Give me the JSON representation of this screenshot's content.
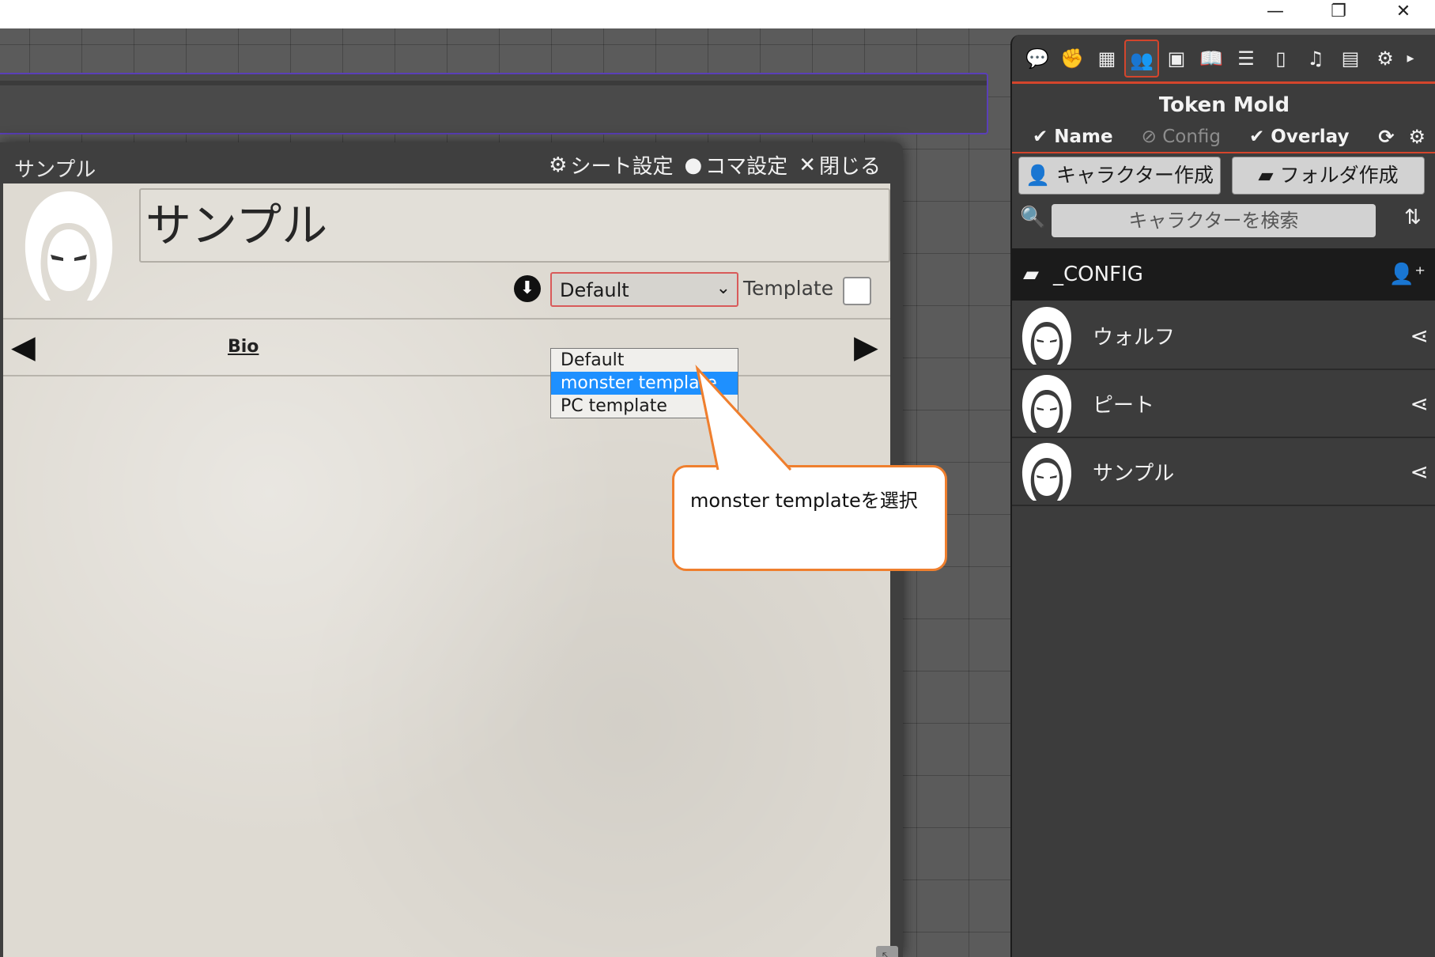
{
  "window_controls": {
    "minimize": "—",
    "restore": "❐",
    "close": "✕"
  },
  "dialog": {
    "title": "サンプル",
    "actions": {
      "sheet_settings": "シート設定",
      "token_settings": "コマ設定",
      "close": "閉じる"
    },
    "character_name": "サンプル",
    "template_select": {
      "selected": "Default",
      "options": [
        "Default",
        "monster template",
        "PC template"
      ],
      "highlighted": "monster template"
    },
    "template_label": "Template",
    "tab": "Bio"
  },
  "callout": {
    "text": "monster templateを選択"
  },
  "sidebar": {
    "title": "Token Mold",
    "toggles": {
      "name": "Name",
      "config": "Config",
      "overlay": "Overlay"
    },
    "create_character": "キャラクター作成",
    "create_folder": "フォルダ作成",
    "search_placeholder": "キャラクターを検索",
    "folder": "_CONFIG",
    "characters": [
      "ウォルフ",
      "ピート",
      "サンプル"
    ]
  },
  "colors": {
    "accent": "#d4452c",
    "dropdown_highlight": "#1e90ff",
    "callout_border": "#ef7f2e"
  }
}
